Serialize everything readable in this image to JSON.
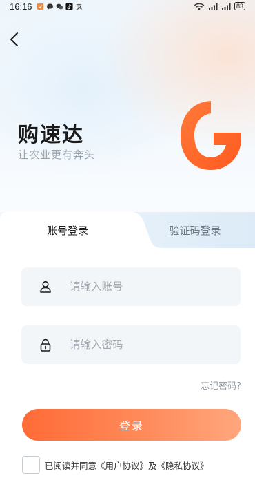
{
  "status_bar": {
    "time": "16:16",
    "battery": "83",
    "left_icons": [
      "shield-app-icon",
      "chat-bubble-icon",
      "wechat-icon",
      "tiktok-icon",
      "alipay-icon"
    ],
    "right_icons": [
      "wifi-icon",
      "signal-icon",
      "signal-icon"
    ]
  },
  "header": {
    "back_icon": "chevron-left-icon"
  },
  "brand": {
    "title": "购速达",
    "slogan": "让农业更有奔头",
    "logo_color": "#ff6a2c"
  },
  "tabs": [
    {
      "label": "账号登录",
      "active": true
    },
    {
      "label": "验证码登录",
      "active": false
    }
  ],
  "form": {
    "account_placeholder": "请输入账号",
    "account_value": "",
    "password_placeholder": "请输入密码",
    "password_value": "",
    "forgot_label": "忘记密码?",
    "login_label": "登录"
  },
  "agreement": {
    "checked": false,
    "text": "已阅读并同意《用户协议》及《隐私协议》"
  },
  "colors": {
    "accent": "#ff6b37",
    "accent_light": "#ffa77d",
    "field_bg": "#f3f6f8"
  }
}
